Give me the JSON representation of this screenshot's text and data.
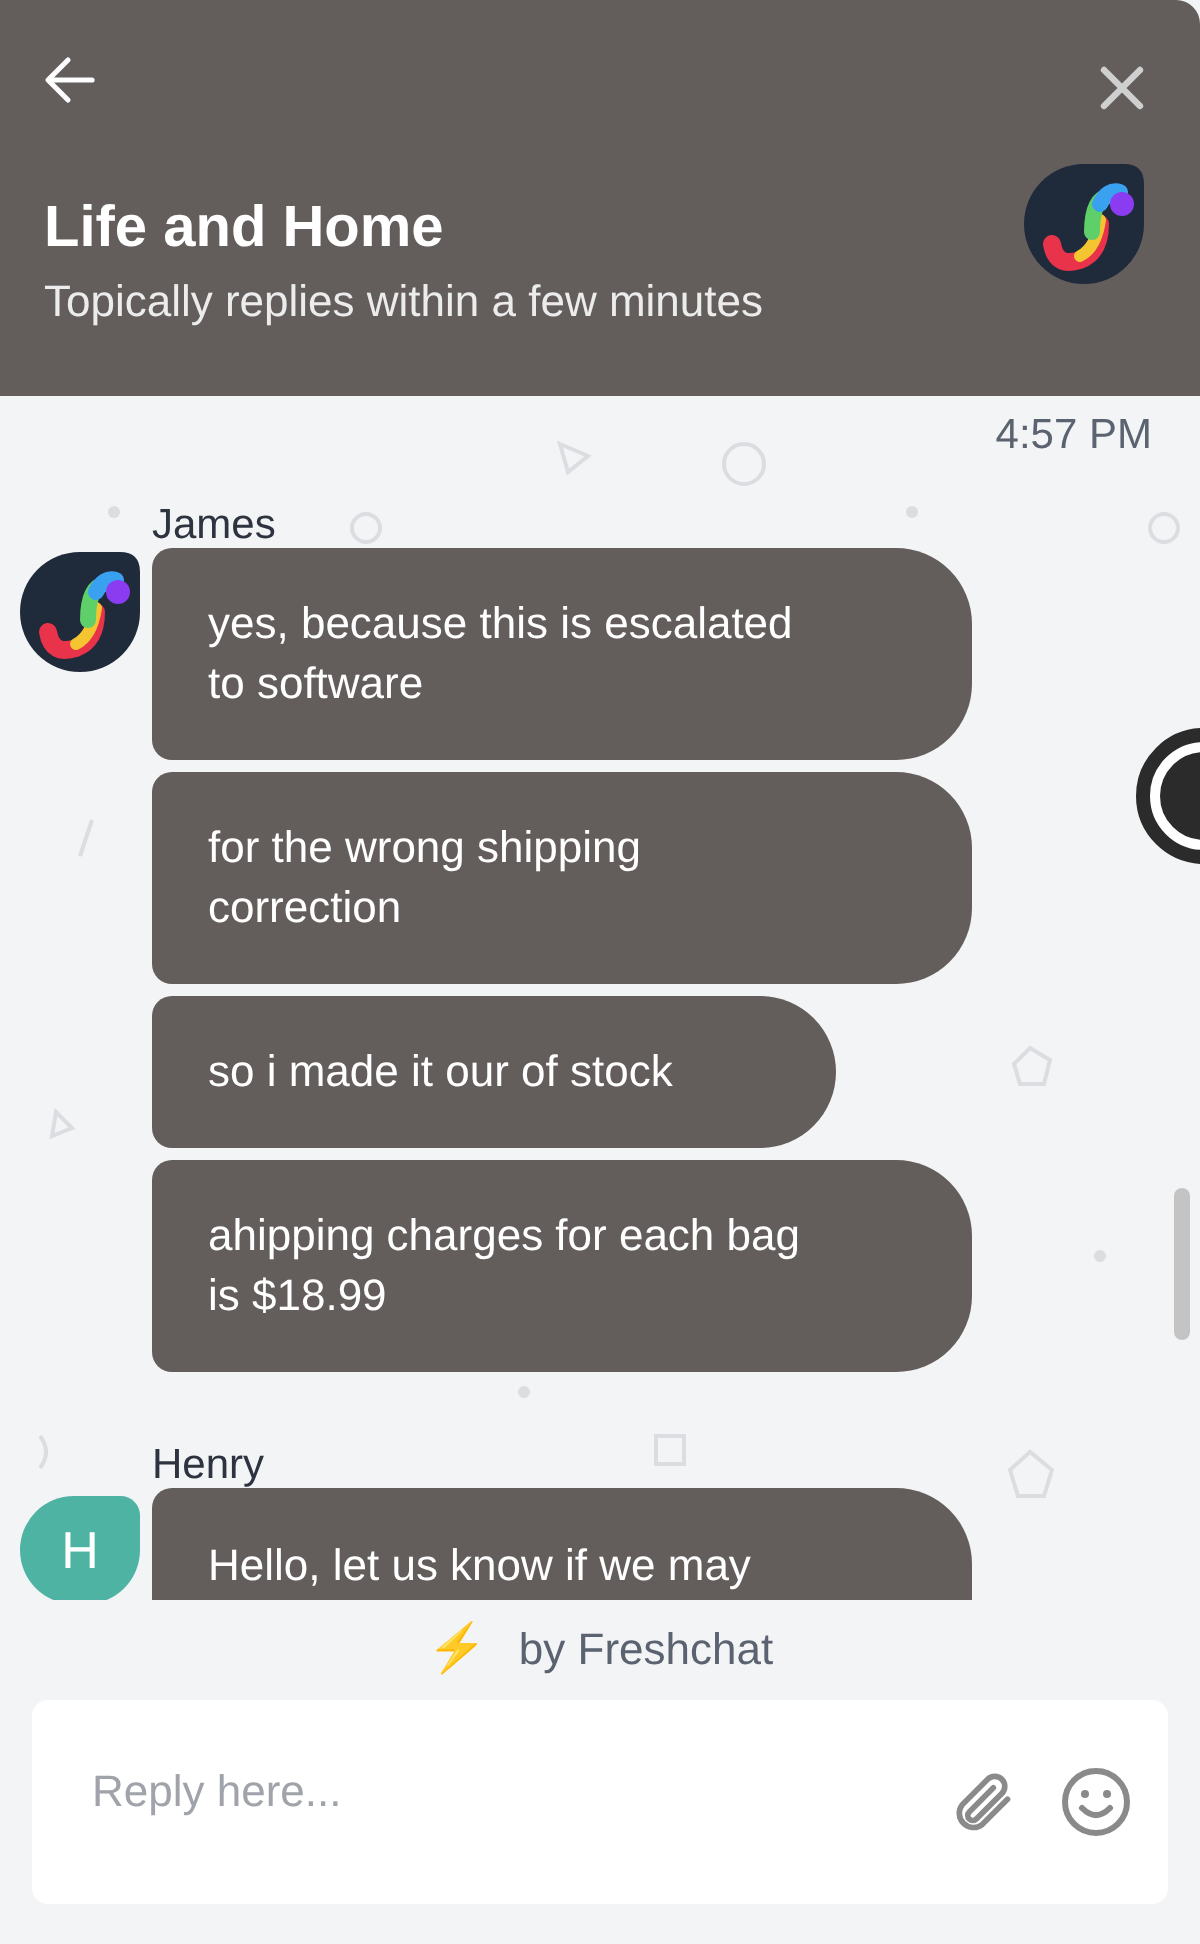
{
  "header": {
    "title": "Life and Home",
    "subtitle": "Topically replies within a few minutes"
  },
  "timestamp": "4:57 PM",
  "groups": [
    {
      "sender": "James",
      "avatar": {
        "kind": "logo"
      },
      "messages": [
        "yes, because this is escalated to software",
        "for the wrong shipping correction",
        "so i made it our of stock",
        "ahipping charges for each bag is $18.99"
      ]
    },
    {
      "sender": "Henry",
      "avatar": {
        "kind": "letter",
        "letter": "H",
        "color": "#4fb3a4"
      },
      "messages": [
        "Hello, let us know if we may"
      ]
    }
  ],
  "branding": {
    "icon": "⚡",
    "text": "by Freshchat"
  },
  "composer": {
    "placeholder": "Reply here..."
  }
}
